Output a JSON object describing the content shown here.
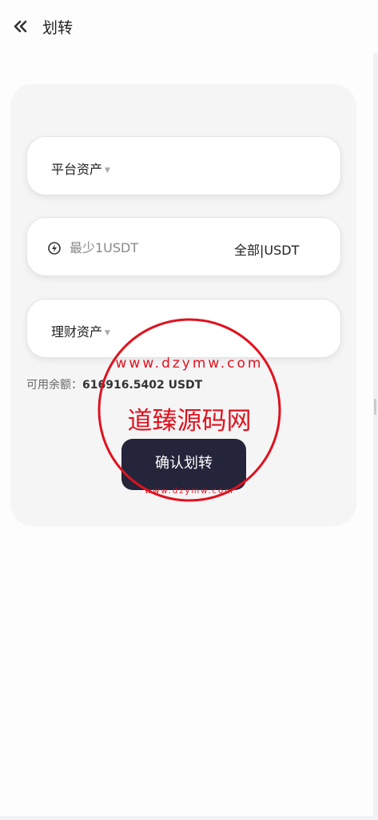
{
  "header": {
    "title": "划转"
  },
  "form": {
    "platform_select": {
      "label": "平台资产"
    },
    "amount": {
      "placeholder": "最少1USDT",
      "all_label": "全部|USDT"
    },
    "finance_select": {
      "label": "理财资产"
    }
  },
  "balance": {
    "label": "可用余额：",
    "value": "616916.5402 USDT"
  },
  "confirm_button": {
    "label": "确认划转"
  },
  "watermark": {
    "text": "道臻源码网",
    "url": "www.dzymw.com",
    "color": "#e0121e"
  }
}
